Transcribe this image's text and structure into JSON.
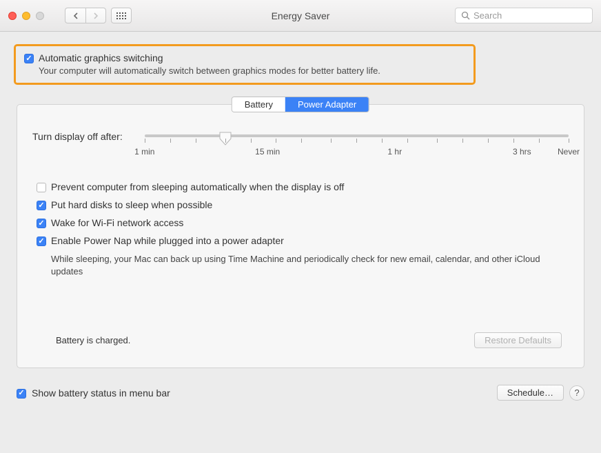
{
  "window": {
    "title": "Energy Saver",
    "search_placeholder": "Search"
  },
  "top": {
    "auto_graphics_label": "Automatic graphics switching",
    "auto_graphics_checked": true,
    "auto_graphics_desc": "Your computer will automatically switch between graphics modes for better battery life."
  },
  "tabs": {
    "battery": "Battery",
    "power_adapter": "Power Adapter",
    "active": "power_adapter"
  },
  "slider": {
    "label": "Turn display off after:",
    "marks": [
      "1 min",
      "15 min",
      "1 hr",
      "3 hrs",
      "Never"
    ]
  },
  "options": {
    "prevent_sleep": {
      "label": "Prevent computer from sleeping automatically when the display is off",
      "checked": false
    },
    "hard_disks": {
      "label": "Put hard disks to sleep when possible",
      "checked": true
    },
    "wake_wifi": {
      "label": "Wake for Wi-Fi network access",
      "checked": true
    },
    "power_nap": {
      "label": "Enable Power Nap while plugged into a power adapter",
      "checked": true,
      "desc": "While sleeping, your Mac can back up using Time Machine and periodically check for new email, calendar, and other iCloud updates"
    }
  },
  "status": "Battery is charged.",
  "buttons": {
    "restore_defaults": "Restore Defaults",
    "schedule": "Schedule…"
  },
  "bottom": {
    "show_battery_label": "Show battery status in menu bar",
    "show_battery_checked": true
  }
}
